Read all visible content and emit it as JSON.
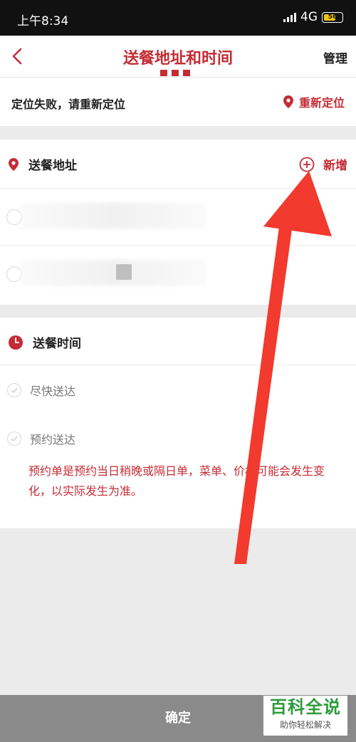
{
  "status_bar": {
    "time": "上午8:34",
    "network": "4G",
    "battery": "56"
  },
  "nav": {
    "title": "送餐地址和时间",
    "manage_label": "管理"
  },
  "location": {
    "message": "定位失败，请重新定位",
    "relocate_label": "重新定位"
  },
  "address_section": {
    "title": "送餐地址",
    "add_label": "新增"
  },
  "time_section": {
    "title": "送餐时间",
    "options": [
      {
        "label": "尽快送达"
      },
      {
        "label": "预约送达"
      }
    ],
    "notice": "预约单是预约当日稍晚或隔日单，菜单、价格可能会发生变化，以实际发生为准。"
  },
  "confirm_label": "确定",
  "watermark": {
    "title": "百科全说",
    "subtitle": "助你轻松解决"
  },
  "colors": {
    "accent": "#c42c35",
    "annotation_arrow": "#f23a2e"
  }
}
